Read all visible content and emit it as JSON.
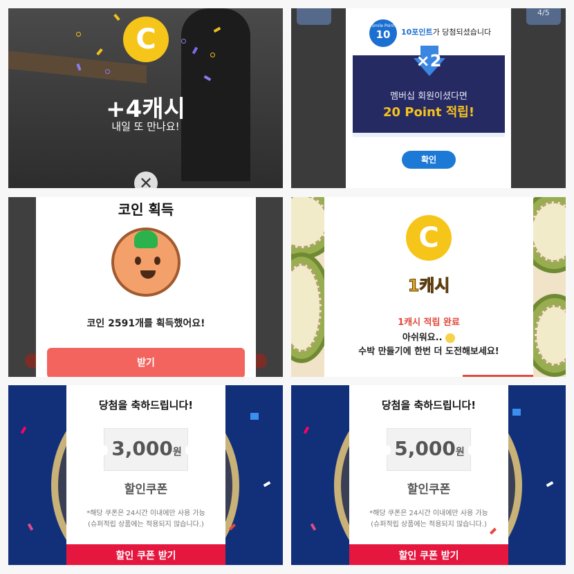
{
  "panel1": {
    "cash_text": "+4캐시",
    "subtitle": "내일 또 만나요!",
    "coin_letter": "C",
    "close_glyph": "✕"
  },
  "panel2": {
    "pager": "4/5",
    "smile_label": "Smile Point",
    "smile_value": "10",
    "point_prefix": "10포인트",
    "point_suffix": "가 당첨되셨습니다",
    "multiplier": "×2",
    "member_line": "멤버십 회원이셨다면",
    "bonus_line": "20 Point 적립!",
    "confirm_button": "확인"
  },
  "panel3": {
    "title": "코인 획득",
    "message": "코인 2591개를 획득했어요!",
    "button": "받기"
  },
  "panel4": {
    "coin_letter": "C",
    "title": "1캐시",
    "done": "1캐시 적립 완료",
    "sorry": "아쉬워요..",
    "again": "수박 만들기에 한번 더 도전해보세요!"
  },
  "panel5": {
    "heading": "당첨을 축하드립니다!",
    "amount": "3,000",
    "unit": "원",
    "coupon_type": "할인쿠폰",
    "note1": "*해당 쿠폰은 24시간 이내에만 사용 가능",
    "note2": "(슈퍼적립 상품에는 적용되지 않습니다.)",
    "button": "할인 쿠폰 받기"
  },
  "panel6": {
    "heading": "당첨을 축하드립니다!",
    "amount": "5,000",
    "unit": "원",
    "coupon_type": "할인쿠폰",
    "note1": "*해당 쿠폰은 24시간 이내에만 사용 가능",
    "note2": "(슈퍼적립 상품에는 적용되지 않습니다.)",
    "button": "할인 쿠폰 받기"
  },
  "colors": {
    "coin_yellow": "#f6c51a",
    "smile_blue": "#1a6fd1",
    "navy": "#262a63",
    "red_button": "#e5173f",
    "salmon_button": "#f4645e"
  }
}
